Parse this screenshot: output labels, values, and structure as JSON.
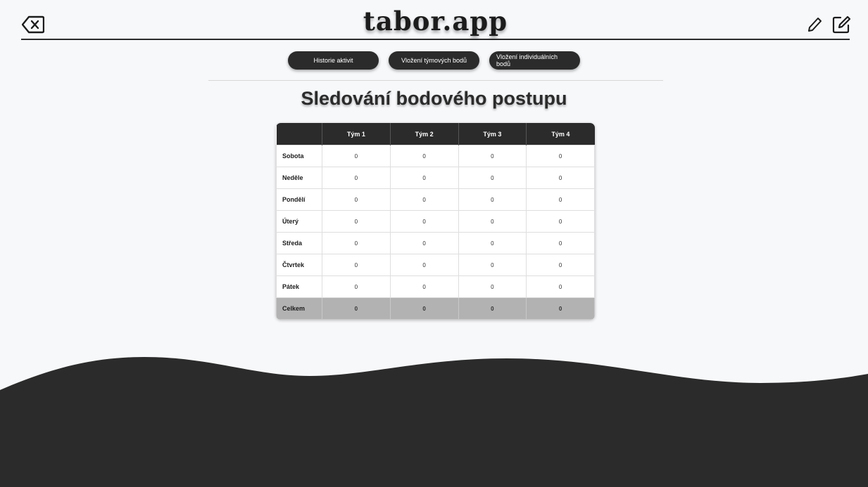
{
  "header": {
    "brand": "tabor.app",
    "icons": [
      "backspace-icon",
      "pencil-icon",
      "edit-note-icon"
    ]
  },
  "tabs": [
    {
      "label": "Historie aktivit"
    },
    {
      "label": "Vložení týmových bodů"
    },
    {
      "label": "Vložení individuálních bodů"
    }
  ],
  "page": {
    "title": "Sledování bodového postupu"
  },
  "table": {
    "columns": [
      "",
      "Tým 1",
      "Tým 2",
      "Tým 3",
      "Tým 4"
    ],
    "rows": [
      {
        "label": "Sobota",
        "values": [
          "0",
          "0",
          "0",
          "0"
        ]
      },
      {
        "label": "Neděle",
        "values": [
          "0",
          "0",
          "0",
          "0"
        ]
      },
      {
        "label": "Pondělí",
        "values": [
          "0",
          "0",
          "0",
          "0"
        ]
      },
      {
        "label": "Úterý",
        "values": [
          "0",
          "0",
          "0",
          "0"
        ]
      },
      {
        "label": "Středa",
        "values": [
          "0",
          "0",
          "0",
          "0"
        ]
      },
      {
        "label": "Čtvrtek",
        "values": [
          "0",
          "0",
          "0",
          "0"
        ]
      },
      {
        "label": "Pátek",
        "values": [
          "0",
          "0",
          "0",
          "0"
        ]
      }
    ],
    "total": {
      "label": "Celkem",
      "values": [
        "0",
        "0",
        "0",
        "0"
      ]
    }
  },
  "colors": {
    "dark": "#2b2b2b",
    "background": "#f7f8fa",
    "total_row": "#b2b2b2"
  }
}
